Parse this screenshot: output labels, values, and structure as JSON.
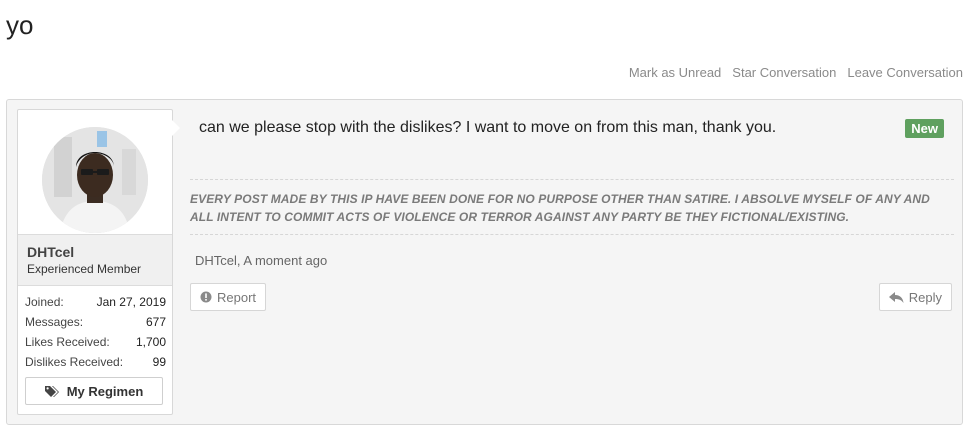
{
  "page": {
    "title": "yo"
  },
  "convo_actions": [
    "Mark as Unread",
    "Star Conversation",
    "Leave Conversation"
  ],
  "user": {
    "name": "DHTcel",
    "title": "Experienced Member",
    "stats": [
      {
        "label": "Joined:",
        "value": "Jan 27, 2019"
      },
      {
        "label": "Messages:",
        "value": "677"
      },
      {
        "label": "Likes Received:",
        "value": "1,700"
      },
      {
        "label": "Dislikes Received:",
        "value": "99"
      }
    ],
    "regimen_button": "My Regimen"
  },
  "message": {
    "text": "can we please stop with the dislikes? I want to move on from this man, thank you.",
    "badge": "New",
    "signature": "EVERY POST MADE BY THIS IP HAVE BEEN DONE FOR NO PURPOSE OTHER THAN SATIRE. I ABSOLVE MYSELF OF ANY AND ALL INTENT TO COMMIT ACTS OF VIOLENCE OR TERROR AGAINST ANY PARTY BE THEY FICTIONAL/EXISTING.",
    "meta": "DHTcel, A moment ago",
    "report_label": "Report",
    "reply_label": "Reply"
  },
  "icons": {
    "regimen": "tags-icon",
    "report": "exclamation-circle-icon",
    "reply": "reply-arrow-icon"
  },
  "colors": {
    "new_badge": "#5fa05f",
    "muted_link": "#8a8a8a"
  }
}
